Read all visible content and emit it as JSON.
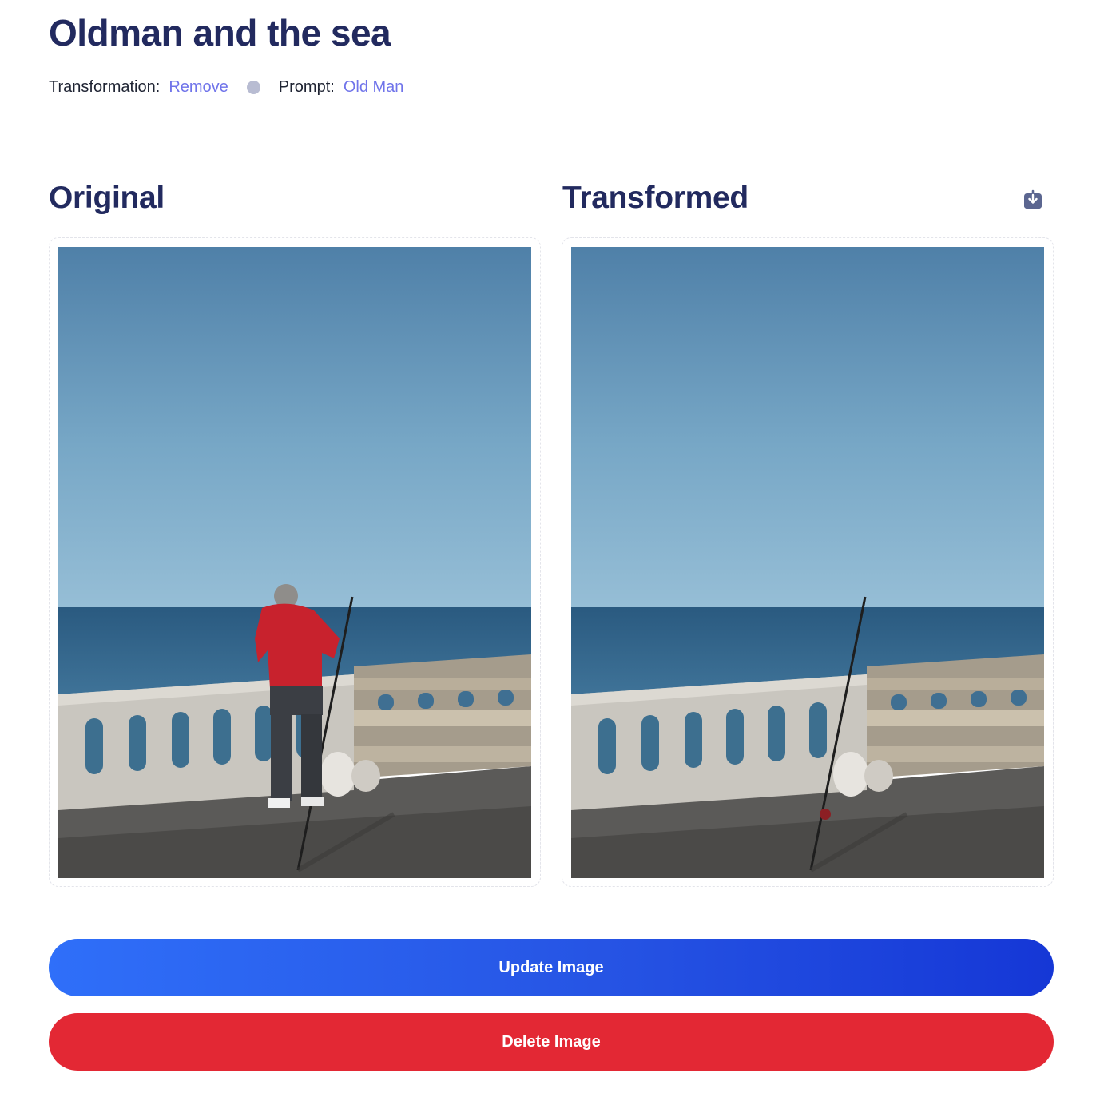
{
  "page": {
    "title": "Oldman and the sea"
  },
  "meta": {
    "transformation_label": "Transformation:",
    "transformation_value": "Remove",
    "prompt_label": "Prompt:",
    "prompt_value": "Old Man"
  },
  "sections": {
    "original_heading": "Original",
    "transformed_heading": "Transformed"
  },
  "icons": {
    "download": "download-icon"
  },
  "actions": {
    "update_label": "Update Image",
    "delete_label": "Delete Image"
  },
  "colors": {
    "title": "#222a5f",
    "accent": "#7074ea",
    "update_gradient_start": "#2f6ff9",
    "update_gradient_end": "#1537d6",
    "delete": "#e32834"
  }
}
